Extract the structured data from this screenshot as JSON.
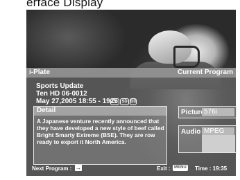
{
  "caption": "erface Display",
  "plate": {
    "title": "i-Plate",
    "current": "Current Program"
  },
  "program": {
    "name": "Sports Update",
    "channel": "Ten HD 06-0012",
    "time": "May 27,2005 18:55 - 1925",
    "badges": [
      "CC",
      "SD",
      "DD"
    ]
  },
  "detail": {
    "heading": "Detail",
    "text": "A Japanese venture recently announced that they have developed a new style of beef called Bright Smarty Extreme (BSE). They are row ready to export it North America."
  },
  "options": {
    "picture_label": "Picture",
    "picture_value": "576i",
    "audio_label": "Audio",
    "audio_value": "MPEG En"
  },
  "footer": {
    "next_label": "Next Program :",
    "next_icon": "→",
    "exit_label": "Exit :",
    "menu_label": "MENU",
    "time_label": "Time : 19:35"
  }
}
